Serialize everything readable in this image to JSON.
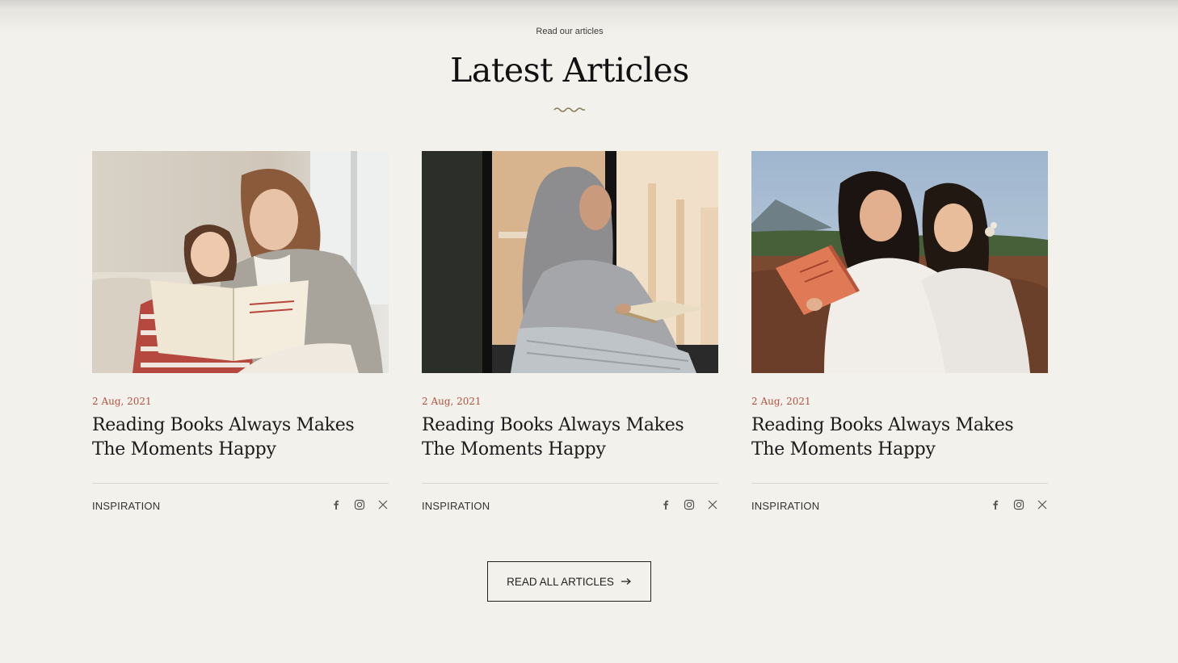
{
  "section": {
    "eyebrow": "Read our articles",
    "title": "Latest Articles"
  },
  "articles": [
    {
      "image_alt": "Mother and daughter reading a book together",
      "date": "2 Aug, 2021",
      "title": "Reading Books Always Makes The Moments Happy",
      "category": "INSPIRATION",
      "socials": [
        "facebook-icon",
        "instagram-icon",
        "x-icon"
      ]
    },
    {
      "image_alt": "Woman in hijab reading a book by a window",
      "date": "2 Aug, 2021",
      "title": "Reading Books Always Makes The Moments Happy",
      "category": "INSPIRATION",
      "socials": [
        "facebook-icon",
        "instagram-icon",
        "x-icon"
      ]
    },
    {
      "image_alt": "Two women in white dresses reading outdoors",
      "date": "2 Aug, 2021",
      "title": "Reading Books Always Makes The Moments Happy",
      "category": "INSPIRATION",
      "socials": [
        "facebook-icon",
        "instagram-icon",
        "x-icon"
      ]
    }
  ],
  "cta": {
    "label": "READ ALL ARTICLES",
    "icon": "arrow-right-icon"
  },
  "colors": {
    "background": "#f3f1ec",
    "date_accent": "#b0543d",
    "squiggle": "#8a7a5a",
    "text": "#1a1a1a"
  }
}
